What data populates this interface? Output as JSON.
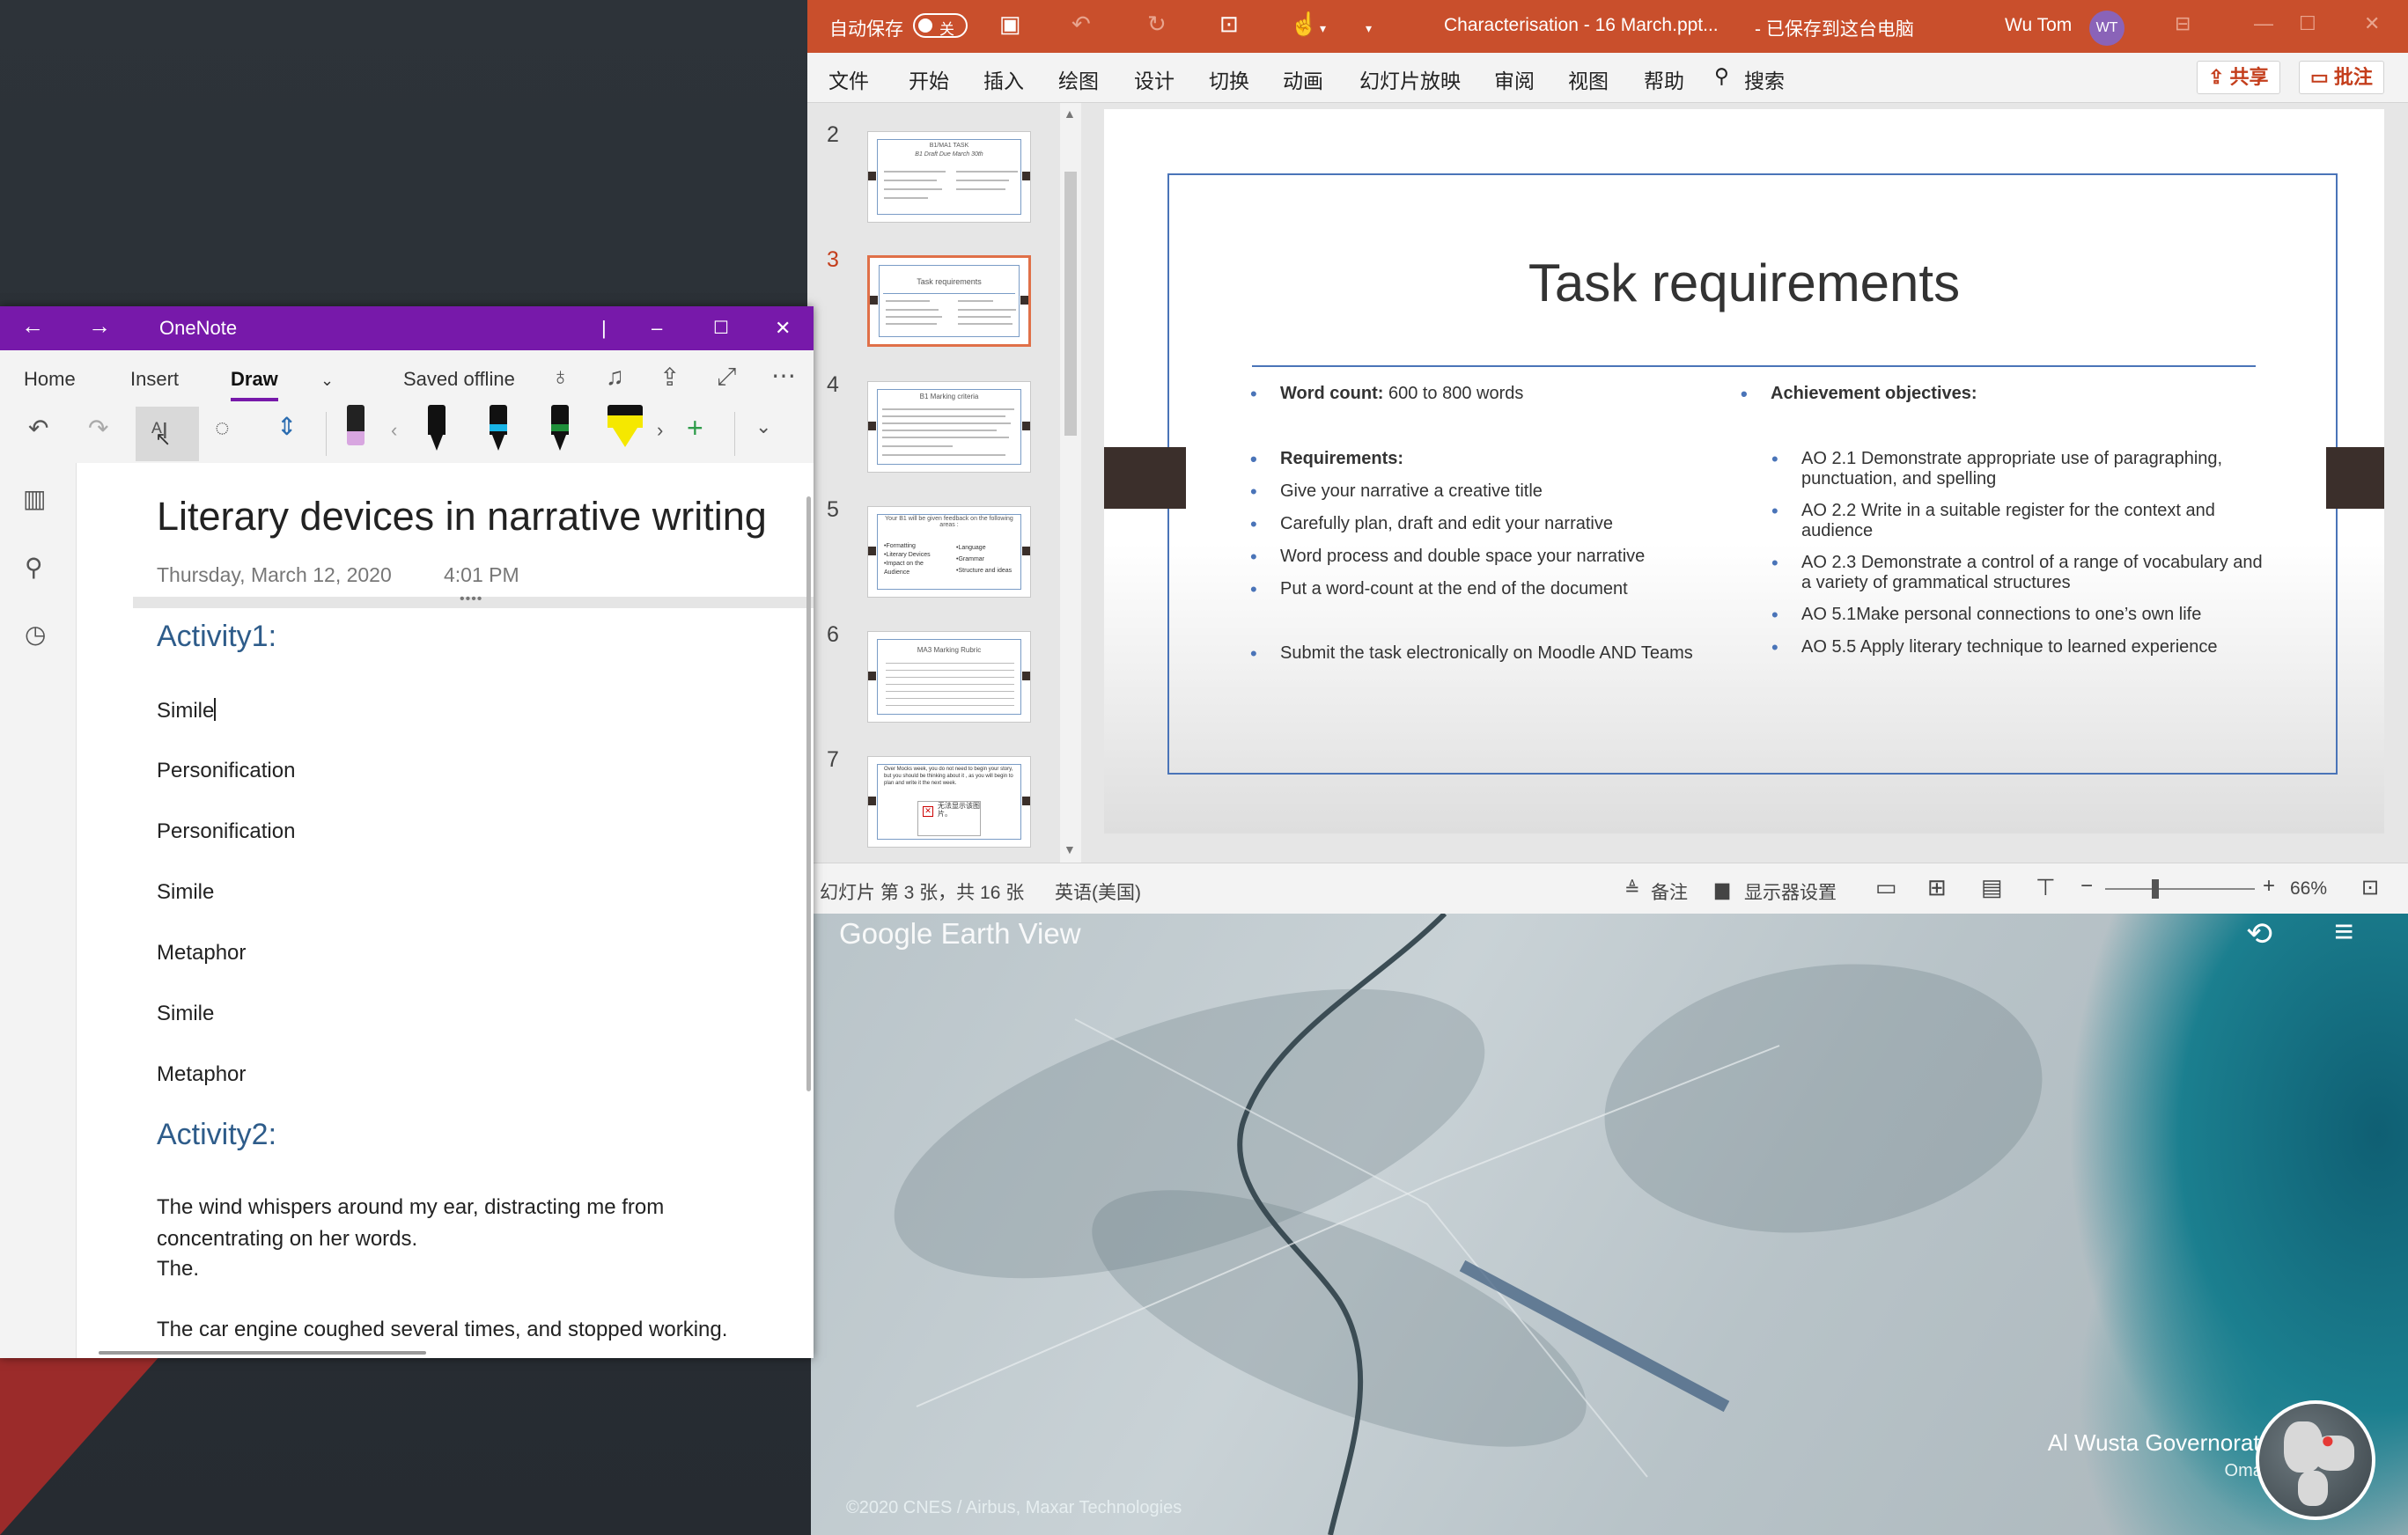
{
  "powerpoint": {
    "autosave_label": "自动保存",
    "autosave_state": "关",
    "doc_title": "Characterisation - 16 March.ppt...",
    "save_status": "已保存到这台电脑",
    "user_name": "Wu Tom",
    "user_initials": "WT",
    "menu": [
      "文件",
      "开始",
      "插入",
      "绘图",
      "设计",
      "切换",
      "动画",
      "幻灯片放映",
      "审阅",
      "视图",
      "帮助"
    ],
    "search_label": "搜索",
    "share_label": "共享",
    "comment_label": "批注",
    "thumbnails": [
      {
        "num": "2",
        "title": "B1/MA1 TASK",
        "subtitle": "B1 Draft Due March 30th"
      },
      {
        "num": "3",
        "title": "Task requirements"
      },
      {
        "num": "4",
        "title": "B1 Marking criteria"
      },
      {
        "num": "5",
        "title": "Your B1 will be given feedback on the following areas :",
        "items": [
          "•Formatting",
          "•Literary Devices",
          "•Impact on the Audience",
          "•Language",
          "•Grammar",
          "•Structure and ideas"
        ]
      },
      {
        "num": "6",
        "title": "MA3 Marking Rubric"
      },
      {
        "num": "7",
        "title": "Over Mocks week, you do not need to begin your story, but you should be thinking about it , as you will begin to plan and write it the next week.",
        "placeholder": "无法显示该图片。"
      }
    ],
    "slide": {
      "title": "Task requirements",
      "left": {
        "word_count_label": "Word count:",
        "word_count_value": " 600 to 800 words",
        "requirements_label": "Requirements:",
        "requirements": [
          "Give your narrative a creative title",
          "Carefully plan, draft and edit your narrative",
          "Word process and double space your narrative",
          "Put a word-count at the end of the document"
        ],
        "submit": "Submit the task electronically on Moodle AND Teams"
      },
      "right": {
        "heading": "Achievement objectives:",
        "objectives": [
          "AO 2.1 Demonstrate appropriate use of paragraphing, punctuation, and spelling",
          "AO 2.2 Write in a suitable register for the context and audience",
          "AO 2.3 Demonstrate a control of a range of vocabulary and a variety of grammatical structures",
          "AO 5.1Make personal connections to one’s own life",
          "AO 5.5 Apply literary technique to learned experience"
        ]
      }
    },
    "status": {
      "slide_info": "幻灯片 第 3 张，共 16 张",
      "language": "英语(美国)",
      "notes": "备注",
      "display_settings": "显示器设置",
      "zoom": "66%",
      "zoom_fraction": 0.66
    }
  },
  "earth": {
    "logo": "Google Earth View",
    "location": "Al Wusta Governorate",
    "country": "Oman",
    "credit": "©2020 CNES / Airbus, Maxar Technologies"
  },
  "onenote": {
    "app_title": "OneNote",
    "tabs": [
      "Home",
      "Insert",
      "Draw"
    ],
    "active_tab": "Draw",
    "sync_status": "Saved offline",
    "page": {
      "title": "Literary devices in narrative writing",
      "date": "Thursday, March 12, 2020",
      "time": "4:01 PM",
      "activity1_heading": "Activity1:",
      "activity1_items": [
        "Simile",
        "Personification",
        "Personification",
        "Simile",
        "Metaphor",
        "Simile",
        "Metaphor"
      ],
      "activity2_heading": "Activity2:",
      "activity2_para1": "The wind whispers around my ear, distracting me from concentrating on her words.",
      "activity2_para1b": "The.",
      "activity2_para2": "The car engine coughed several times, and stopped working."
    },
    "pen_colors": {
      "black_pen": "#111111",
      "cyan_pen": "#19b4e6",
      "green_pen": "#1f8f3a",
      "yellow_highlighter": "#f5e800",
      "eraser_band": "#d8a6e0"
    }
  },
  "colors": {
    "powerpoint_accent": "#c94f2c",
    "onenote_accent": "#7719aa",
    "slide_blue": "#4a74b8",
    "activity_heading": "#2e5c8a"
  }
}
